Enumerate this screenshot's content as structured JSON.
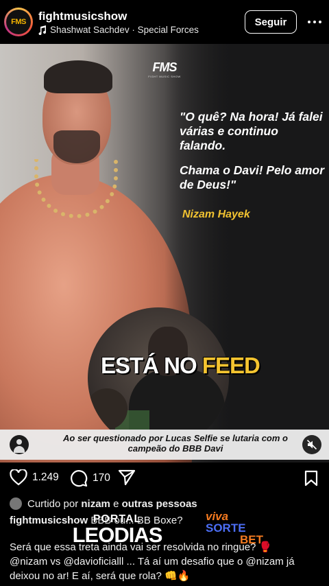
{
  "header": {
    "avatar_text": "FMS",
    "username": "fightmusicshow",
    "music": "Shashwat Sachdev · Special Forces",
    "follow_label": "Seguir"
  },
  "media": {
    "logo_main": "FMS",
    "logo_sub": "FIGHT MUSIC SHOW",
    "quote_line1": "\"O quê? Na hora! Já falei várias e continuo falando.",
    "quote_line2": "Chama o Davi! Pelo amor de Deus!\"",
    "quote_author": "Nizam Hayek",
    "overlay_text_a": "ESTÁ NO ",
    "overlay_text_b": "FEED",
    "caption": "Ao ser questionado por Lucas Selfie se lutaria com o campeão do BBB Davi"
  },
  "actions": {
    "likes": "1.249",
    "comments": "170"
  },
  "liked_by": {
    "prefix": "Curtido por",
    "user": "nizam",
    "connector": "e",
    "others": "outras pessoas"
  },
  "post": {
    "username": "fightmusicshow",
    "title": "BBB ou... BB Boxe?",
    "line2": "Será que essa treta ainda vai ser resolvida no ringue? 🥊",
    "line3": "@nizam vs @davioficialll ... Tá aí um desafio que o @nizam já deixou no ar! E aí, será que rola? 👊🔥"
  },
  "overlays": {
    "leodias_top": "PORTAL",
    "leodias_main": "LEODIAS",
    "viva_1": "viva",
    "viva_2": "SORTE",
    "viva_3": "BET"
  },
  "colors": {
    "accent_yellow": "#f2c331",
    "background": "#000000"
  },
  "icons": [
    "music-note-icon",
    "more-icon",
    "user-icon",
    "mute-icon",
    "heart-icon",
    "comment-icon",
    "share-icon",
    "bookmark-icon"
  ]
}
